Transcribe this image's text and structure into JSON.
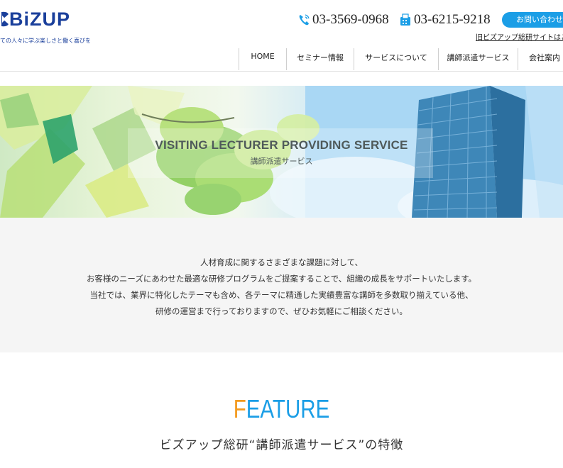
{
  "header": {
    "logo_text": "BiZUP",
    "tagline": "ての人々に学ぶ楽しさと働く喜びを",
    "phone_primary": "03-3569-0968",
    "phone_fax": "03-6215-9218",
    "contact_label": "お問い合わせ",
    "old_site_link": "旧ビズアップ総研サイトはこち",
    "brand_color": "#1a3f9b",
    "accent_color": "#1b9ee6"
  },
  "nav": {
    "items": [
      {
        "label": "HOME"
      },
      {
        "label": "セミナー情報"
      },
      {
        "label": "サービスについて"
      },
      {
        "label": "講師派遣サービス"
      },
      {
        "label": "会社案内"
      }
    ]
  },
  "hero": {
    "title": "VISITING LECTURER PROVIDING SERVICE",
    "subtitle": "講師派遣サービス"
  },
  "intro": {
    "lines": [
      "人材育成に関するさまざまな課題に対して、",
      "お客様のニーズにあわせた最適な研修プログラムをご提案することで、組織の成長をサポートいたします。",
      "当社では、業界に特化したテーマも含め、各テーマに精通した実績豊富な講師を多数取り揃えている他、",
      "研修の運営まで行っておりますので、ぜひお気軽にご相談ください。"
    ]
  },
  "feature": {
    "title_first": "F",
    "title_rest": "EATURE",
    "subtitle": "ビズアップ総研“講師派遣サービス”の特徴",
    "first_letter_color": "#f39a1e"
  }
}
